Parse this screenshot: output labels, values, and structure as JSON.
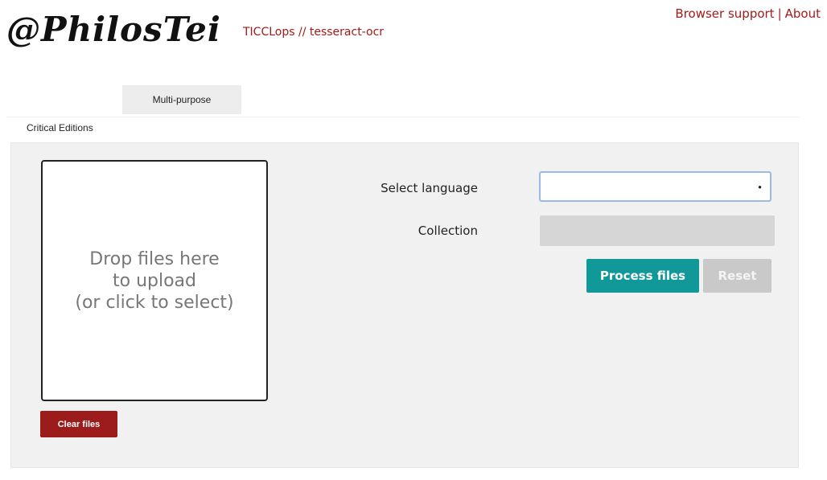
{
  "header": {
    "logo_text": "@PhilosTei",
    "subtitle": "TICCLops // tesseract-ocr",
    "links": {
      "browser_support": "Browser support",
      "separator": "|",
      "about": "About"
    }
  },
  "tabs": {
    "multi_purpose": "Multi-purpose",
    "critical_editions": "Critical Editions"
  },
  "upload": {
    "line1": "Drop files here",
    "line2": "to upload",
    "line3": "(or click to select)",
    "clear_label": "Clear files"
  },
  "form": {
    "language_label": "Select language",
    "language_value": "",
    "collection_label": "Collection",
    "collection_value": "",
    "process_label": "Process files",
    "reset_label": "Reset"
  },
  "colors": {
    "accent_red": "#a31a1a",
    "button_red": "#9c1b1b",
    "teal": "#11999a"
  }
}
